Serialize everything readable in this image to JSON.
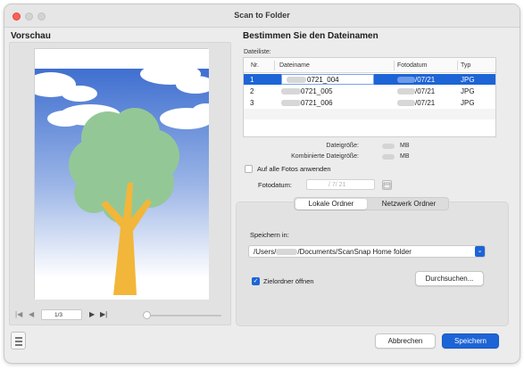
{
  "window": {
    "title": "Scan to Folder"
  },
  "preview": {
    "heading": "Vorschau",
    "page_indicator": "1/3",
    "icons": [
      "first-page-icon",
      "prev-page-icon",
      "next-page-icon",
      "last-page-icon"
    ]
  },
  "filename": {
    "heading": "Bestimmen Sie den Dateinamen",
    "list_label": "Dateiliste:",
    "columns": [
      "Nr.",
      "Dateiname",
      "Fotodatum",
      "Typ"
    ],
    "rows": [
      {
        "nr": "1",
        "name": "0721_004",
        "date": "/07/21",
        "type": "JPG"
      },
      {
        "nr": "2",
        "name": "0721_005",
        "date": "/07/21",
        "type": "JPG"
      },
      {
        "nr": "3",
        "name": "0721_006",
        "date": "/07/21",
        "type": "JPG"
      }
    ],
    "selected_row": 1,
    "file_size_label": "Dateigröße:",
    "file_size_unit": "MB",
    "combined_size_label": "Kombinierte Dateigröße:",
    "combined_size_unit": "MB",
    "apply_all_label": "Auf alle Fotos anwenden",
    "photo_date_label": "Fotodatum:",
    "photo_date_value": "/  7/ 21"
  },
  "save": {
    "tabs": [
      "Lokale Ordner",
      "Netzwerk Ordner"
    ],
    "active_tab": 0,
    "save_in_label": "Speichern in:",
    "path_prefix": "/Users/",
    "path_suffix": "/Documents/ScanSnap Home folder",
    "open_folder_label": "Zielordner öffnen",
    "open_folder_checked": true,
    "browse_label": "Durchsuchen..."
  },
  "footer": {
    "cancel_label": "Abbrechen",
    "save_label": "Speichern"
  },
  "colors": {
    "accent": "#1d64d6",
    "sky": "#3f6fd0",
    "tree": "#93c896",
    "trunk": "#f2b63a"
  }
}
